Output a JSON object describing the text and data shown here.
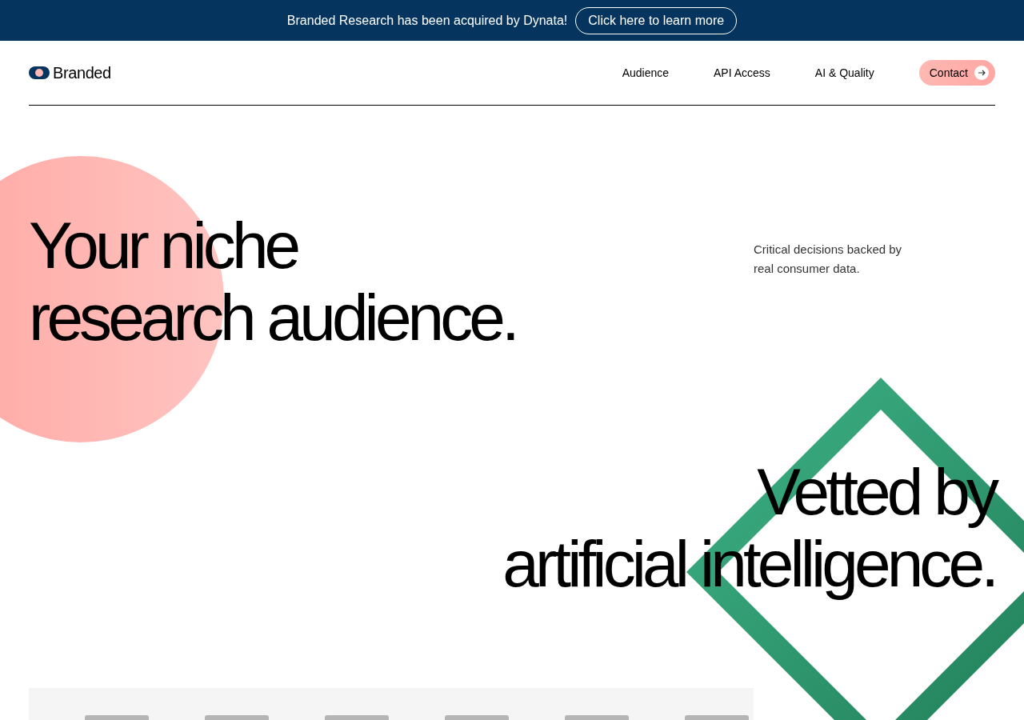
{
  "banner": {
    "text": "Branded Research has been acquired by Dynata!",
    "link": "Click here to learn more"
  },
  "nav": {
    "logo": "Branded",
    "links": [
      "Audience",
      "API Access",
      "AI & Quality"
    ],
    "contact": "Contact"
  },
  "hero": {
    "headline": [
      "Your niche",
      "research audience."
    ],
    "subtitle": "Critical decisions backed by real consumer data.",
    "second_headline": [
      "Vetted by",
      "artificial intelligence."
    ]
  }
}
